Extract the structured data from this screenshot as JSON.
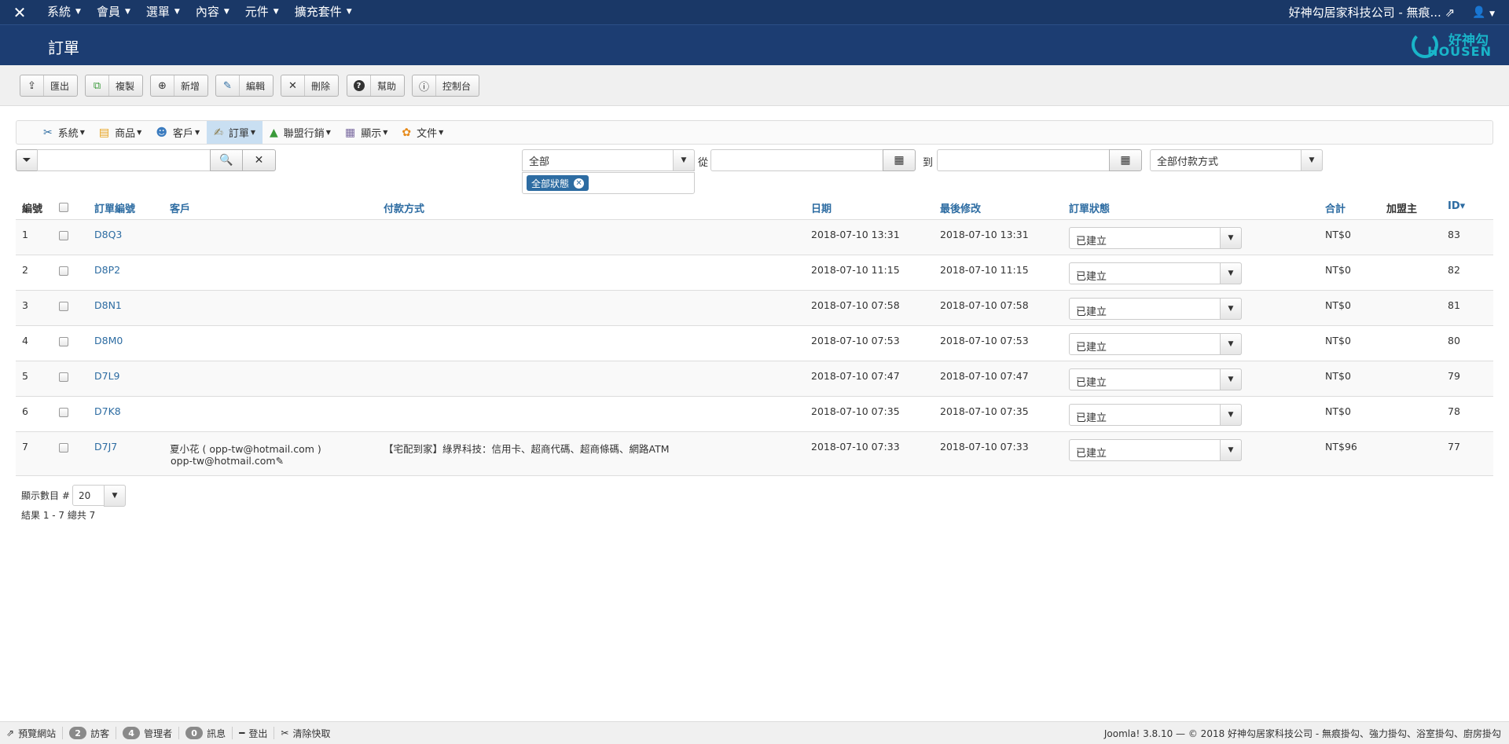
{
  "topnav": {
    "logo_icon": "joomla-icon",
    "menu": [
      {
        "label": "系統"
      },
      {
        "label": "會員"
      },
      {
        "label": "選單"
      },
      {
        "label": "內容"
      },
      {
        "label": "元件"
      },
      {
        "label": "擴充套件"
      }
    ],
    "site_label": "好神勾居家科技公司 - 無痕...",
    "user_icon": "user-icon"
  },
  "header": {
    "title": "訂單",
    "brand_top": "好神勾",
    "brand_bottom": "HOUSEN"
  },
  "toolbar": {
    "buttons": [
      {
        "label": "匯出",
        "icon": "export-icon",
        "glyph": "⇪"
      },
      {
        "label": "複製",
        "icon": "copy-icon",
        "glyph": "⧉"
      },
      {
        "label": "新增",
        "icon": "add-icon",
        "glyph": "⊕"
      },
      {
        "label": "編輯",
        "icon": "edit-icon",
        "glyph": "✎"
      },
      {
        "label": "刪除",
        "icon": "delete-icon",
        "glyph": "✕"
      },
      {
        "label": "幫助",
        "icon": "help-icon",
        "glyph": "?"
      },
      {
        "label": "控制台",
        "icon": "info-icon",
        "glyph": "ⓘ"
      }
    ]
  },
  "submenu": [
    {
      "label": "系統",
      "icon": "tools-icon",
      "glyph": "✂",
      "active": false
    },
    {
      "label": "商品",
      "icon": "products-icon",
      "glyph": "▤",
      "active": false
    },
    {
      "label": "客戶",
      "icon": "customers-icon",
      "glyph": "☻",
      "active": false
    },
    {
      "label": "訂單",
      "icon": "orders-icon",
      "glyph": "✍",
      "active": true
    },
    {
      "label": "聯盟行銷",
      "icon": "affiliate-icon",
      "glyph": "▲",
      "active": false
    },
    {
      "label": "顯示",
      "icon": "display-icon",
      "glyph": "▦",
      "active": false
    },
    {
      "label": "文件",
      "icon": "docs-icon",
      "glyph": "✿",
      "active": false
    }
  ],
  "filters": {
    "search_value": "",
    "status_select": "全部",
    "status_chip": "全部狀態",
    "from_label": "從",
    "to_label": "到",
    "from_value": "",
    "to_value": "",
    "payment_select": "全部付款方式"
  },
  "table": {
    "headers": {
      "num": "編號",
      "order_no": "訂單編號",
      "customer": "客戶",
      "payment": "付款方式",
      "date": "日期",
      "modified": "最後修改",
      "status": "訂單狀態",
      "total": "合計",
      "affiliate": "加盟主",
      "id": "ID"
    },
    "sort_indicator": "▾",
    "rows": [
      {
        "num": "1",
        "order_no": "D8Q3",
        "customer": "",
        "customer_email": "",
        "payment": "",
        "date": "2018-07-10 13:31",
        "modified": "2018-07-10 13:31",
        "status": "已建立",
        "total": "NT$0",
        "affiliate": "",
        "id": "83"
      },
      {
        "num": "2",
        "order_no": "D8P2",
        "customer": "",
        "customer_email": "",
        "payment": "",
        "date": "2018-07-10 11:15",
        "modified": "2018-07-10 11:15",
        "status": "已建立",
        "total": "NT$0",
        "affiliate": "",
        "id": "82"
      },
      {
        "num": "3",
        "order_no": "D8N1",
        "customer": "",
        "customer_email": "",
        "payment": "",
        "date": "2018-07-10 07:58",
        "modified": "2018-07-10 07:58",
        "status": "已建立",
        "total": "NT$0",
        "affiliate": "",
        "id": "81"
      },
      {
        "num": "4",
        "order_no": "D8M0",
        "customer": "",
        "customer_email": "",
        "payment": "",
        "date": "2018-07-10 07:53",
        "modified": "2018-07-10 07:53",
        "status": "已建立",
        "total": "NT$0",
        "affiliate": "",
        "id": "80"
      },
      {
        "num": "5",
        "order_no": "D7L9",
        "customer": "",
        "customer_email": "",
        "payment": "",
        "date": "2018-07-10 07:47",
        "modified": "2018-07-10 07:47",
        "status": "已建立",
        "total": "NT$0",
        "affiliate": "",
        "id": "79"
      },
      {
        "num": "6",
        "order_no": "D7K8",
        "customer": "",
        "customer_email": "",
        "payment": "",
        "date": "2018-07-10 07:35",
        "modified": "2018-07-10 07:35",
        "status": "已建立",
        "total": "NT$0",
        "affiliate": "",
        "id": "78"
      },
      {
        "num": "7",
        "order_no": "D7J7",
        "customer": "夏小花 ( opp-tw@hotmail.com )",
        "customer_email": "opp-tw@hotmail.com",
        "payment": "【宅配到家】綠界科技：信用卡、超商代碼、超商條碼、網路ATM",
        "date": "2018-07-10 07:33",
        "modified": "2018-07-10 07:33",
        "status": "已建立",
        "total": "NT$96",
        "affiliate": "",
        "id": "77"
      }
    ]
  },
  "pagination": {
    "limit_label": "顯示數目 #",
    "limit_value": "20",
    "result_text": "結果 1 - 7 總共 7"
  },
  "statusbar": {
    "preview": "預覽網站",
    "visitors_count": "2",
    "visitors_label": "訪客",
    "admins_count": "4",
    "admins_label": "管理者",
    "messages_count": "0",
    "messages_label": "訊息",
    "logout": "登出",
    "clear_cache": "清除快取",
    "footer": "Joomla! 3.8.10 — © 2018 好神勾居家科技公司 - 無痕掛勾、強力掛勾、浴室掛勾、廚房掛勾"
  }
}
